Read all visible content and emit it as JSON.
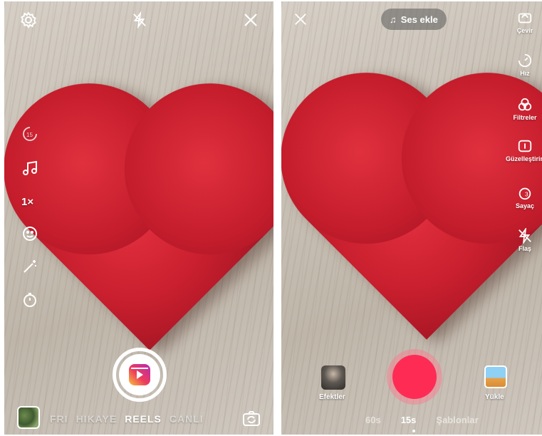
{
  "instagram": {
    "speed_label": "1×",
    "mode_tabs": [
      "FRI",
      "HIKAYE",
      "REELS",
      "CANLI"
    ],
    "active_mode": "REELS",
    "icons": [
      "settings-icon",
      "flash-off-icon",
      "close-icon",
      "timer-15-icon",
      "music-icon",
      "speed-label",
      "effects-face-icon",
      "magic-wand-icon",
      "countdown-timer-icon",
      "camera-flip-icon"
    ]
  },
  "tiktok": {
    "sound_label": "Ses ekle",
    "tools": [
      {
        "label": "Çevir",
        "icon": "flip-camera-icon"
      },
      {
        "label": "Hız",
        "icon": "speed-icon"
      },
      {
        "label": "Filtreler",
        "icon": "filters-icon"
      },
      {
        "label": "Güzelleştirin",
        "icon": "beautify-icon"
      },
      {
        "label": "Sayaç",
        "icon": "countdown-icon"
      },
      {
        "label": "Flaş",
        "icon": "flash-icon"
      }
    ],
    "effects_label": "Efektler",
    "upload_label": "Yükle",
    "duration_tabs": [
      "60s",
      "15s",
      "Şablonlar"
    ],
    "active_duration": "15s"
  }
}
